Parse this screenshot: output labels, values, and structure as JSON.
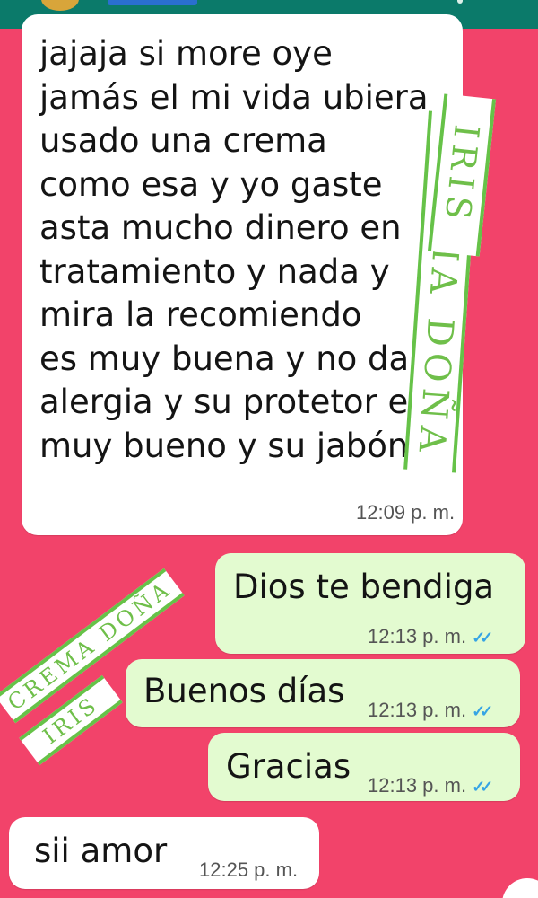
{
  "messages": [
    {
      "direction": "incoming",
      "text": "jajaja si more oye\njamás el mi vida ubiera\nusado una crema\ncomo esa y yo gaste\nasta mucho dinero en\ntratamiento y nada y\nmira la recomiendo\nes muy buena y no da\nalergia y su protetor es\nmuy bueno y su jabón",
      "time": "12:09 p. m."
    },
    {
      "direction": "outgoing",
      "text": "Dios te bendiga",
      "time": "12:13 p. m.",
      "status": "read"
    },
    {
      "direction": "outgoing",
      "text": "Buenos días",
      "time": "12:13 p. m.",
      "status": "read"
    },
    {
      "direction": "outgoing",
      "text": "Gracias",
      "time": "12:13 p. m.",
      "status": "read"
    },
    {
      "direction": "incoming",
      "text": "sii amor",
      "time": "12:25 p. m."
    }
  ],
  "watermarks": {
    "brand": "CREMA DOÑA",
    "name": "IRIS"
  },
  "colors": {
    "background": "#f2436a",
    "incoming_bubble": "#ffffff",
    "outgoing_bubble": "#e3fbd0",
    "read_ticks": "#37a4e4",
    "header": "#0b7a6a",
    "stamp_text": "#6fbf4a"
  },
  "icons": {
    "read_status": "double-check-icon"
  }
}
